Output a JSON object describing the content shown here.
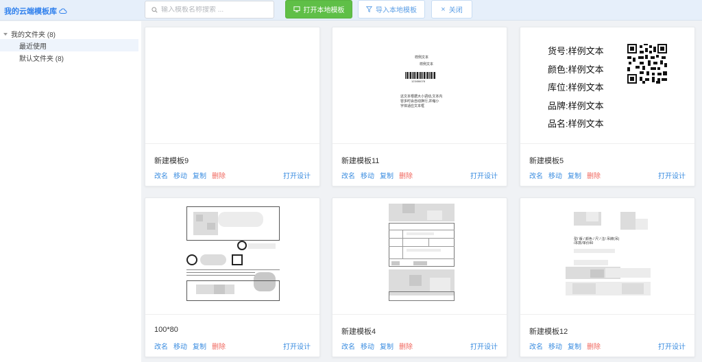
{
  "header": {
    "brand": "我的云端模板库",
    "search_placeholder": "输入模板名称搜索 ...",
    "open_local": "打开本地模板",
    "import_local": "导入本地模板",
    "close": "关闭"
  },
  "sidebar": {
    "root": "我的文件夹 (8)",
    "items": [
      {
        "label": "最近使用"
      },
      {
        "label": "默认文件夹 (8)"
      }
    ]
  },
  "card_actions": {
    "rename": "改名",
    "move": "移动",
    "copy": "复制",
    "delete": "删除",
    "open_design": "打开设计"
  },
  "cards": [
    {
      "title": "新建模板9"
    },
    {
      "title": "新建模板11",
      "preview": {
        "line1": "样例文本",
        "line2": "样例文本",
        "barcode": "123456078",
        "para": [
          "这文本根据大小调动,文本内",
          "容多时会自动换行,并缩小",
          "字体适应文本框"
        ]
      }
    },
    {
      "title": "新建模板5",
      "preview": {
        "rows": [
          "货号:样例文本",
          "颜色:样例文本",
          "库位:样例文本",
          "品牌:样例文本",
          "品名:样例文本"
        ]
      }
    },
    {
      "title": "100*80"
    },
    {
      "title": "新建模板4"
    },
    {
      "title": "新建模板12",
      "preview": {
        "line1": "型/ 版 / 颜色 / 尺 / 注/ 吊牌(吊)",
        "line2": "/本款/单价80"
      }
    }
  ]
}
